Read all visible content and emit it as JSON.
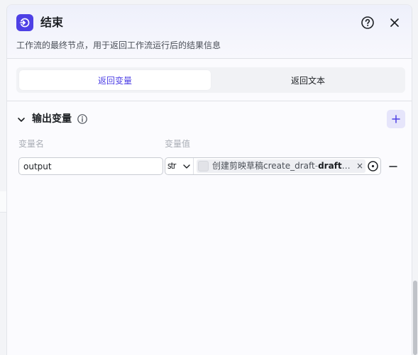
{
  "node": {
    "title": "结束",
    "description": "工作流的最终节点，用于返回工作流运行后的结果信息",
    "accent_color": "#4e40e5"
  },
  "header": {
    "help_icon": "help-circle-icon",
    "close_icon": "close-icon"
  },
  "tabs": [
    {
      "label": "返回变量",
      "active": true
    },
    {
      "label": "返回文本",
      "active": false
    }
  ],
  "output_section": {
    "title": "输出变量",
    "info_icon": "info-icon",
    "add_icon": "plus-icon",
    "columns": {
      "name": "变量名",
      "value": "变量值"
    },
    "rows": [
      {
        "name": "output",
        "type": "str",
        "reference": {
          "node": "创建剪映草稿create_draft",
          "separator": "-",
          "field": "draft...",
          "remove_symbol": "×"
        }
      }
    ]
  }
}
